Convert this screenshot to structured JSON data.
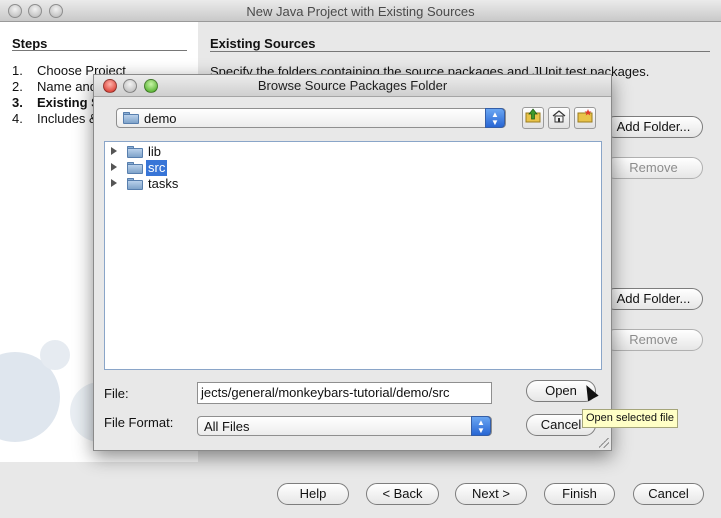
{
  "window": {
    "title": "New Java Project with Existing Sources"
  },
  "steps": {
    "heading": "Steps",
    "items": [
      {
        "num": "1.",
        "label": "Choose Project"
      },
      {
        "num": "2.",
        "label": "Name and Location"
      },
      {
        "num": "3.",
        "label": "Existing Sources"
      },
      {
        "num": "4.",
        "label": "Includes & Excludes"
      }
    ]
  },
  "content": {
    "title": "Existing Sources",
    "description": "Specify the folders containing the source packages and JUnit test packages.",
    "source_add_label": "Add Folder...",
    "source_remove_label": "Remove",
    "test_add_label": "Add Folder...",
    "test_remove_label": "Remove"
  },
  "footer": {
    "help": "Help",
    "back": "< Back",
    "next": "Next >",
    "finish": "Finish",
    "cancel": "Cancel"
  },
  "dialog": {
    "title": "Browse Source Packages Folder",
    "look_in": "demo",
    "toolbar_icons": [
      "up-one-level-icon",
      "home-folder-icon",
      "new-folder-icon"
    ],
    "tree": [
      {
        "name": "lib",
        "selected": false
      },
      {
        "name": "src",
        "selected": true
      },
      {
        "name": "tasks",
        "selected": false
      }
    ],
    "file_label": "File:",
    "file_value": "jects/general/monkeybars-tutorial/demo/src",
    "format_label": "File Format:",
    "format_value": "All Files",
    "open_label": "Open",
    "cancel_label": "Cancel",
    "open_tooltip": "Open selected file"
  },
  "colors": {
    "selection": "#3875d7",
    "combo_arrow": "#2866d4",
    "tooltip_bg": "#ffffc6"
  }
}
